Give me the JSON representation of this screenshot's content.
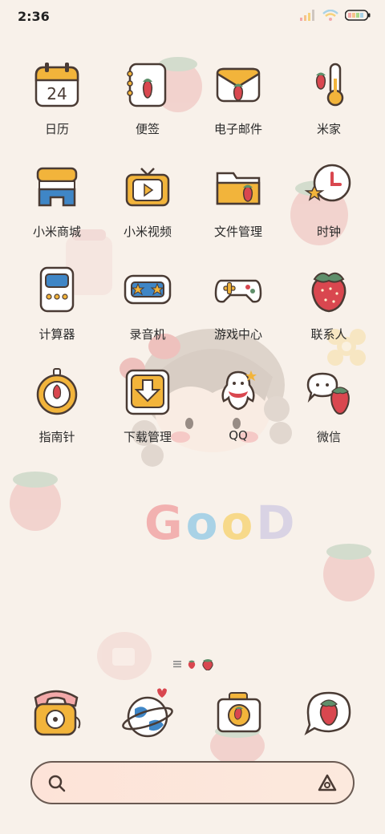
{
  "status_bar": {
    "time": "2:36"
  },
  "apps": [
    {
      "label": "日历",
      "name": "calendar-app",
      "icon": "calendar-icon",
      "day": "24"
    },
    {
      "label": "便签",
      "name": "notes-app",
      "icon": "notes-icon"
    },
    {
      "label": "电子邮件",
      "name": "email-app",
      "icon": "email-icon"
    },
    {
      "label": "米家",
      "name": "mijia-app",
      "icon": "thermometer-icon"
    },
    {
      "label": "小米商城",
      "name": "mi-store-app",
      "icon": "store-icon"
    },
    {
      "label": "小米视频",
      "name": "mi-video-app",
      "icon": "tv-icon"
    },
    {
      "label": "文件管理",
      "name": "file-manager-app",
      "icon": "folder-icon"
    },
    {
      "label": "时钟",
      "name": "clock-app",
      "icon": "clock-icon"
    },
    {
      "label": "计算器",
      "name": "calculator-app",
      "icon": "calculator-icon"
    },
    {
      "label": "录音机",
      "name": "recorder-app",
      "icon": "recorder-icon"
    },
    {
      "label": "游戏中心",
      "name": "game-center-app",
      "icon": "gamepad-icon"
    },
    {
      "label": "联系人",
      "name": "contacts-app",
      "icon": "strawberry-icon"
    },
    {
      "label": "指南针",
      "name": "compass-app",
      "icon": "compass-icon"
    },
    {
      "label": "下载管理",
      "name": "download-manager-app",
      "icon": "download-icon"
    },
    {
      "label": "QQ",
      "name": "qq-app",
      "icon": "qq-penguin-icon"
    },
    {
      "label": "微信",
      "name": "wechat-app",
      "icon": "chat-bubble-icon"
    }
  ],
  "wallpaper_text": {
    "g": "G",
    "o1": "o",
    "o2": "o",
    "d": "D"
  },
  "dock": [
    {
      "name": "phone-dock-app",
      "icon": "telephone-icon"
    },
    {
      "name": "browser-dock-app",
      "icon": "planet-icon"
    },
    {
      "name": "camera-dock-app",
      "icon": "camera-icon"
    },
    {
      "name": "messages-dock-app",
      "icon": "message-bubble-icon"
    }
  ],
  "colors": {
    "background": "#f8f1ea",
    "strawberry_red": "#d9474f",
    "leaf_green": "#5f8f6b",
    "accent_yellow": "#f2b43b",
    "outline": "#4a3b34"
  }
}
